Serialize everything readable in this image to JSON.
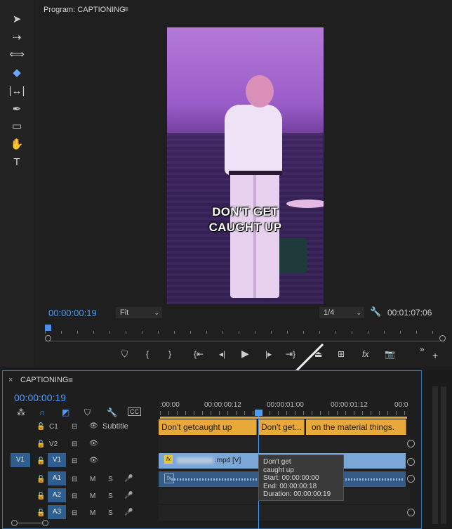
{
  "program": {
    "title": "Program: CAPTIONING",
    "menu_glyph": "≡",
    "caption_line1": "DON'T GET",
    "caption_line2": "CAUGHT UP",
    "current_timecode": "00:00:00:19",
    "fit": "Fit",
    "resolution": "1/4",
    "duration": "00:01:07:06"
  },
  "timeline": {
    "title": "CAPTIONING",
    "menu_glyph": "≡",
    "timecode": "00:00:00:19",
    "ruler_labels": [
      ":00:00",
      "00:00:00:12",
      "00:00:01:00",
      "00:00:01:12",
      "00:0"
    ],
    "tracks": {
      "c1": "C1",
      "v2": "V2",
      "v1": "V1",
      "v1_source": "V1",
      "a1": "A1",
      "a2": "A2",
      "a3": "A3",
      "subtitle": "Subtitle",
      "m": "M",
      "s": "S"
    },
    "captions": [
      "Don't getcaught up",
      "Don't get...",
      "on the material things."
    ],
    "video_clip_name": ".mp4 [V]",
    "cc_label": "CC"
  },
  "tooltip": {
    "line1": "Don't get",
    "line2": "caught up",
    "start": "Start: 00:00:00:00",
    "end": "End: 00:00:00:18",
    "duration": "Duration: 00:00:00:19"
  },
  "icons": {
    "selection": "selection-arrow-icon",
    "track_select": "track-select-icon",
    "ripple": "ripple-edit-icon",
    "razor": "razor-icon",
    "slip": "slip-icon",
    "pen": "pen-icon",
    "rectangle": "rectangle-icon",
    "hand": "hand-icon",
    "type": "type-icon"
  }
}
